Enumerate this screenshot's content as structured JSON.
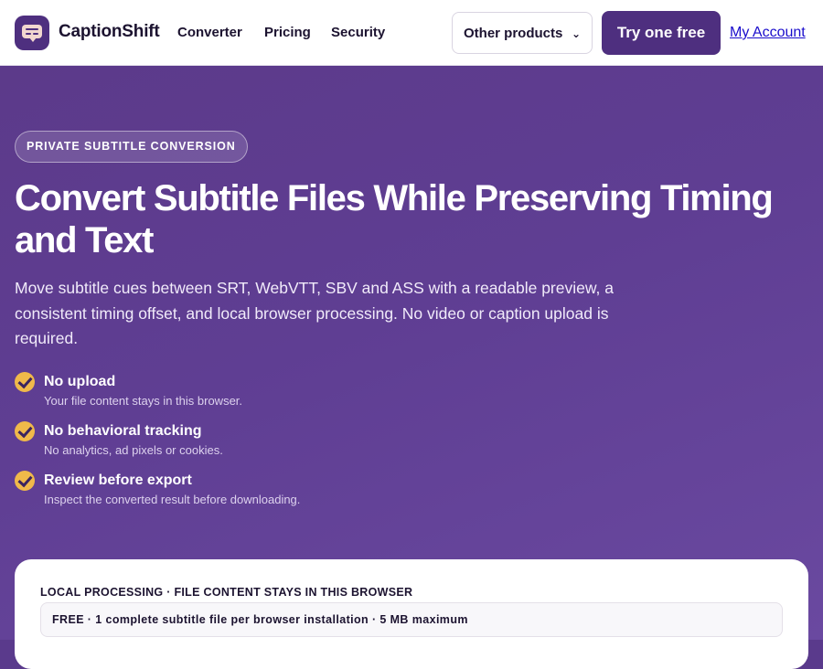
{
  "header": {
    "brand": "CaptionShift",
    "nav": [
      "Converter",
      "Pricing",
      "Security"
    ],
    "other_products": "Other products",
    "other_products_chevron": "⌄",
    "cta": "Try one free",
    "account": "My Account"
  },
  "hero": {
    "eyebrow": "PRIVATE SUBTITLE CONVERSION",
    "headline": "Convert Subtitle Files While Preserving Timing and Text",
    "lead": "Move subtitle cues between SRT, WebVTT, SBV and ASS with a readable preview, a consistent timing offset, and local browser processing. No video or caption upload is required.",
    "features": [
      {
        "title": "No upload",
        "desc": "Your file content stays in this browser."
      },
      {
        "title": "No behavioral tracking",
        "desc": "No analytics, ad pixels or cookies."
      },
      {
        "title": "Review before export",
        "desc": "Inspect the converted result before downloading."
      }
    ]
  },
  "converter": {
    "label": "LOCAL PROCESSING · FILE CONTENT STAYS IN THIS BROWSER",
    "tier": "FREE · 1 complete subtitle file per browser installation · 5 MB maximum"
  },
  "colors": {
    "brand": "#4e2f7f",
    "hero_bg": "#5f3e93",
    "check": "#f0b94a",
    "link": "#1a0dcc"
  },
  "icons": {
    "logo": "caption-bubble-icon",
    "feature": "check-circle-icon",
    "dropdown": "chevron-down-icon"
  }
}
